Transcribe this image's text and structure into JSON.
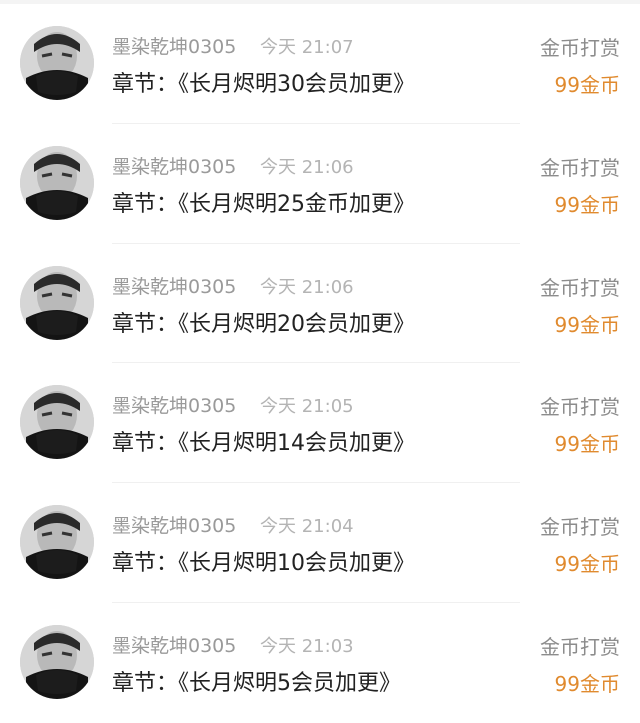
{
  "colors": {
    "accent": "#e08a2e",
    "muted_text": "#9a9a9a",
    "primary_text": "#222222"
  },
  "records": [
    {
      "username": "墨染乾坤0305",
      "time": "今天 21:07",
      "chapter": "章节：《长月烬明30会员加更》",
      "reward_type": "金币打赏",
      "reward_amount": "99金币"
    },
    {
      "username": "墨染乾坤0305",
      "time": "今天 21:06",
      "chapter": "章节：《长月烬明25金币加更》",
      "reward_type": "金币打赏",
      "reward_amount": "99金币"
    },
    {
      "username": "墨染乾坤0305",
      "time": "今天 21:06",
      "chapter": "章节：《长月烬明20会员加更》",
      "reward_type": "金币打赏",
      "reward_amount": "99金币"
    },
    {
      "username": "墨染乾坤0305",
      "time": "今天 21:05",
      "chapter": "章节：《长月烬明14会员加更》",
      "reward_type": "金币打赏",
      "reward_amount": "99金币"
    },
    {
      "username": "墨染乾坤0305",
      "time": "今天 21:04",
      "chapter": "章节：《长月烬明10会员加更》",
      "reward_type": "金币打赏",
      "reward_amount": "99金币"
    },
    {
      "username": "墨染乾坤0305",
      "time": "今天 21:03",
      "chapter": "章节：《长月烬明5会员加更》",
      "reward_type": "金币打赏",
      "reward_amount": "99金币"
    }
  ]
}
